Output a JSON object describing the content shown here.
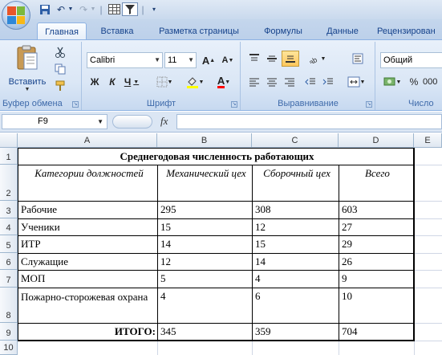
{
  "quick_access": {
    "icons": [
      "save-icon",
      "undo-icon",
      "redo-icon",
      "table-icon",
      "filter-icon",
      "customize-icon"
    ]
  },
  "tabs": [
    {
      "label": "Главная",
      "active": true
    },
    {
      "label": "Вставка"
    },
    {
      "label": "Разметка страницы"
    },
    {
      "label": "Формулы"
    },
    {
      "label": "Данные"
    },
    {
      "label": "Рецензирован"
    }
  ],
  "ribbon": {
    "clipboard": {
      "label": "Буфер обмена",
      "paste": "Вставить"
    },
    "font": {
      "label": "Шрифт",
      "name": "Calibri",
      "size": "11",
      "bold": "Ж",
      "italic": "К",
      "underline": "Ч",
      "grow": "A",
      "shrink": "A",
      "font_color": "A"
    },
    "alignment": {
      "label": "Выравнивание"
    },
    "number": {
      "label": "Число",
      "format": "Общий",
      "percent": "%",
      "thousands": "000"
    }
  },
  "formula_bar": {
    "cell_ref": "F9",
    "fx": "fx",
    "value": ""
  },
  "columns": [
    "A",
    "B",
    "C",
    "D",
    "E"
  ],
  "rows": [
    "1",
    "2",
    "3",
    "4",
    "5",
    "6",
    "7",
    "8",
    "9",
    "10"
  ],
  "sheet": {
    "title": "Среднегодовая численность работающих",
    "headers": [
      "Категории должностей",
      "Механический цех",
      "Сборочный цех",
      "Всего"
    ],
    "data": [
      [
        "Рабочие",
        "295",
        "308",
        "603"
      ],
      [
        "Ученики",
        "15",
        "12",
        "27"
      ],
      [
        "ИТР",
        "14",
        "15",
        "29"
      ],
      [
        "Служащие",
        "12",
        "14",
        "26"
      ],
      [
        "МОП",
        "5",
        "4",
        "9"
      ],
      [
        "Пожарно-сторожевая охрана",
        "4",
        "6",
        "10"
      ]
    ],
    "total": [
      "ИТОГО:",
      "345",
      "359",
      "704"
    ]
  }
}
